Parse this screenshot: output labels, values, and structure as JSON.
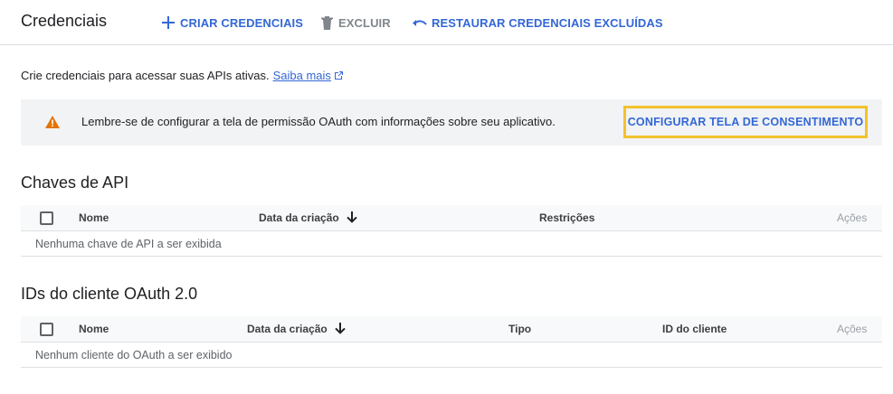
{
  "header": {
    "title": "Credenciais",
    "create_label": "CRIAR CREDENCIAIS",
    "delete_label": "EXCLUIR",
    "restore_label": "RESTAURAR CREDENCIAIS EXCLUÍDAS"
  },
  "intro": {
    "text": "Crie credenciais para acessar suas APIs ativas.",
    "link": "Saiba mais"
  },
  "banner": {
    "message": "Lembre-se de configurar a tela de permissão OAuth com informações sobre seu aplicativo.",
    "button": "CONFIGURAR TELA DE CONSENTIMENTO",
    "highlight_color": "#f2c22f",
    "warning_color": "#e37400"
  },
  "api_keys": {
    "title": "Chaves de API",
    "columns": [
      "Nome",
      "Data da criação",
      "Restrições",
      "Ações"
    ],
    "empty_text": "Nenhuma chave de API a ser exibida"
  },
  "oauth_clients": {
    "title": "IDs do cliente OAuth 2.0",
    "columns": [
      "Nome",
      "Data da criação",
      "Tipo",
      "ID do cliente",
      "Ações"
    ],
    "empty_text": "Nenhum cliente do OAuth a ser exibido"
  },
  "icons": {
    "create": "plus-icon",
    "delete": "trash-icon",
    "restore": "undo-icon",
    "external": "external-link-icon",
    "warning": "warning-icon",
    "sort": "arrow-down-icon"
  },
  "colors": {
    "link_blue": "#3367d6",
    "disabled_grey": "#80868b"
  }
}
